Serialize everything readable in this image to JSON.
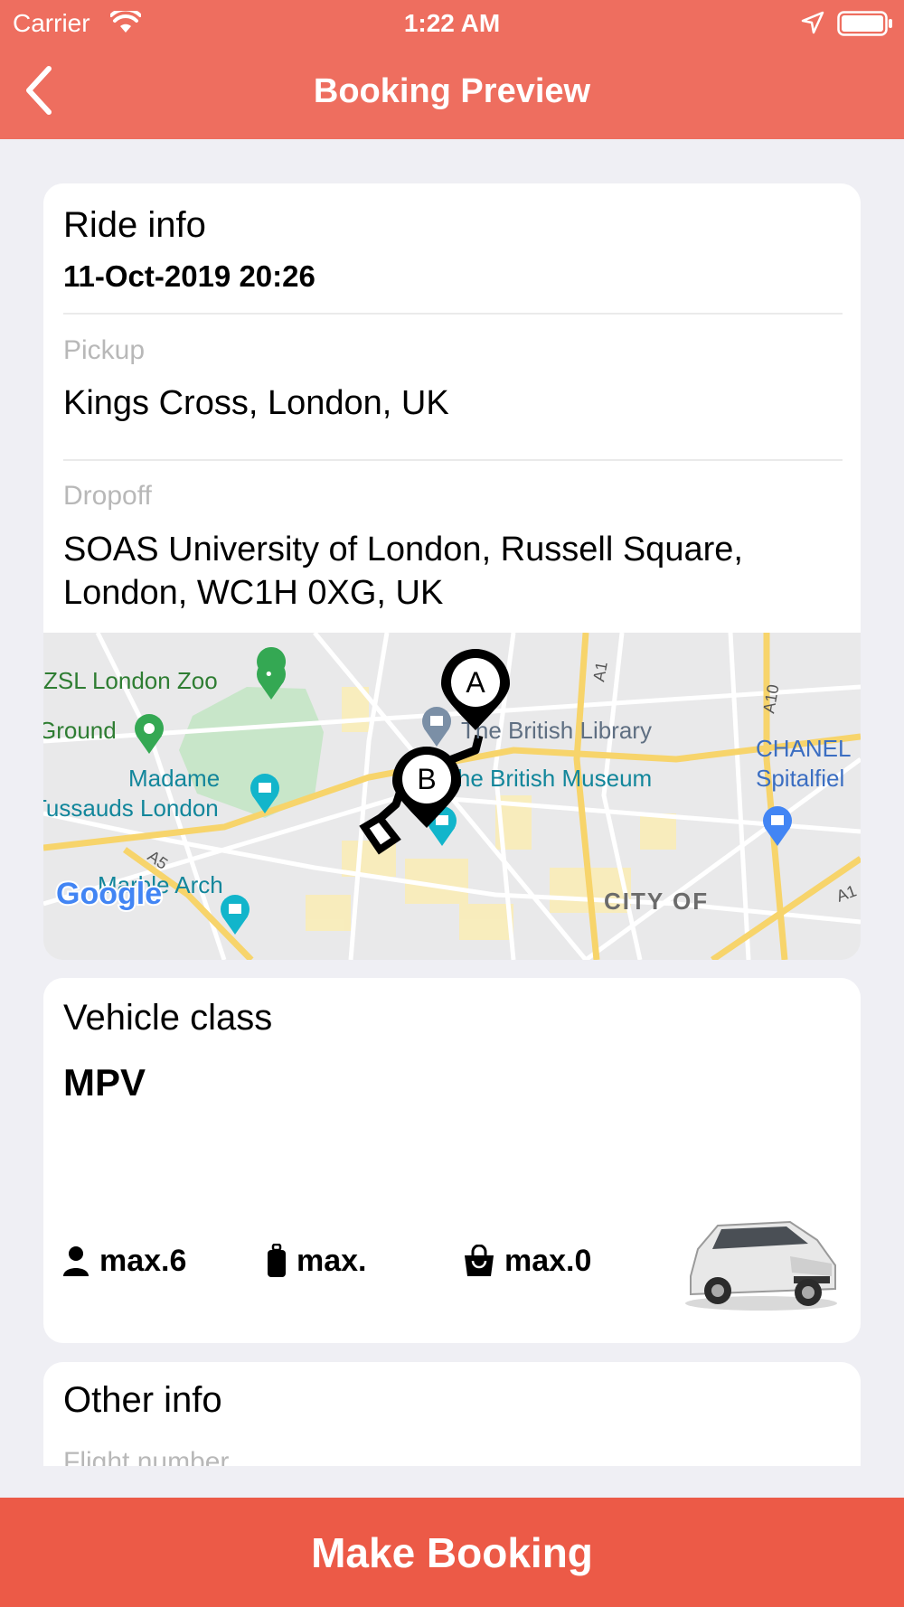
{
  "status_bar": {
    "carrier": "Carrier",
    "time": "1:22 AM"
  },
  "nav": {
    "title": "Booking Preview",
    "back_icon": "chevron-left-icon"
  },
  "ride_info": {
    "heading": "Ride info",
    "datetime": "11-Oct-2019 20:26",
    "pickup_label": "Pickup",
    "pickup_value": "Kings Cross, London, UK",
    "dropoff_label": "Dropoff",
    "dropoff_value": "SOAS University of London, Russell Square, London,  WC1H 0XG, UK"
  },
  "map": {
    "labels": {
      "zoo": "ZSL London Zoo",
      "ground": "Ground",
      "madame_1": "Madame",
      "madame_2": "Tussauds London",
      "british_library": "The British Library",
      "british_museum": "The British Museum",
      "chanel": "CHANEL",
      "spitalfields": "Spitalfiel",
      "marble_arch": "Marble Arch",
      "city_of": "CITY OF",
      "road_a1": "A1",
      "road_a10": "A10",
      "road_a5": "A5",
      "road_a1_b": "A1"
    },
    "marker_a": "A",
    "marker_b": "B",
    "google_logo": "Google"
  },
  "vehicle": {
    "heading": "Vehicle class",
    "name": "MPV",
    "passengers": "max.6",
    "luggage": "max.",
    "bags": "max.0",
    "passengers_icon": "person-icon",
    "luggage_icon": "suitcase-icon",
    "bags_icon": "bag-icon"
  },
  "other_info": {
    "heading": "Other info",
    "flight_label": "Flight number"
  },
  "actions": {
    "make_booking": "Make Booking"
  },
  "colors": {
    "header": "#ee6e5f",
    "button": "#ec5a47",
    "background": "#efeff4"
  }
}
